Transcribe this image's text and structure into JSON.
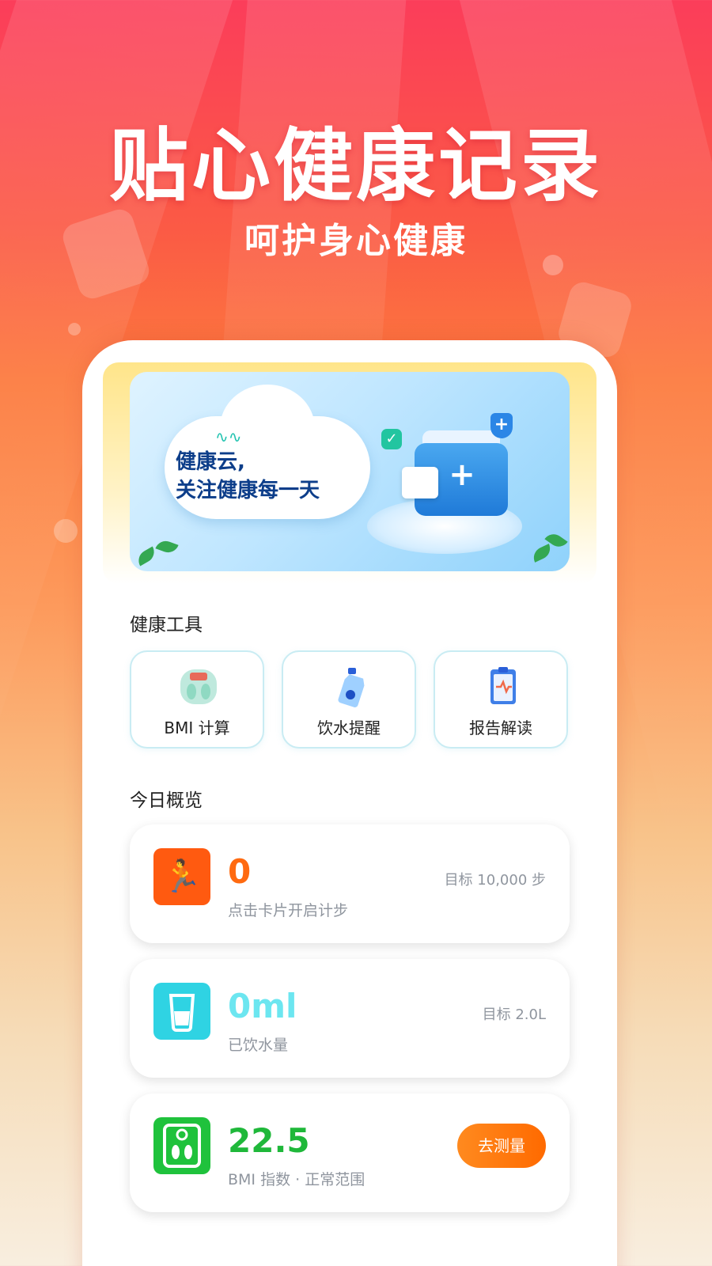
{
  "hero": {
    "title": "贴心健康记录",
    "subtitle": "呵护身心健康"
  },
  "banner": {
    "line1": "健康云,",
    "line2": "关注健康每一天"
  },
  "tools": {
    "section_title": "健康工具",
    "items": [
      {
        "label": "BMI 计算",
        "icon": "scale-icon"
      },
      {
        "label": "饮水提醒",
        "icon": "water-bottle-icon"
      },
      {
        "label": "报告解读",
        "icon": "clipboard-report-icon"
      }
    ]
  },
  "overview": {
    "section_title": "今日概览",
    "steps": {
      "value": "0",
      "sub": "点击卡片开启计步",
      "goal": "目标 10,000 步",
      "color": "#ff6a10"
    },
    "water": {
      "value": "0ml",
      "sub": "已饮水量",
      "goal": "目标 2.0L",
      "color": "#5de0ec"
    },
    "bmi": {
      "value": "22.5",
      "sub": "BMI 指数 · 正常范围",
      "button": "去测量",
      "color": "#1fb83a"
    }
  }
}
